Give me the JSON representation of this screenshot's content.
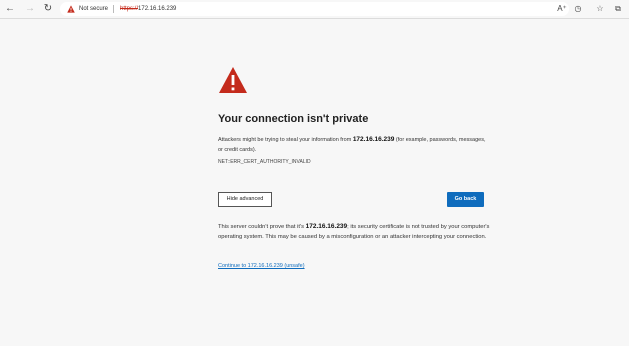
{
  "browser": {
    "security_status": "Not secure",
    "url_scheme": "https://",
    "url_host": "172.16.16.239"
  },
  "page": {
    "heading": "Your connection isn't private",
    "intro_before": "Attackers might be trying to steal your information from ",
    "intro_host": "172.16.16.239",
    "intro_after": " (for example, passwords, messages, or credit cards).",
    "error_code": "NET::ERR_CERT_AUTHORITY_INVALID",
    "hide_advanced_label": "Hide advanced",
    "go_back_label": "Go back",
    "advanced_before": "This server couldn't prove that it's ",
    "advanced_host": "172.16.16.239",
    "advanced_after": "; its security certificate is not trusted by your computer's operating system. This may be caused by a misconfiguration or an attacker intercepting your connection.",
    "proceed_link": "Continue to 172.16.16.239 (unsafe)"
  },
  "colors": {
    "warning_red": "#c42b1c",
    "accent_blue": "#0f6cbd",
    "page_background": "#f7f7f7"
  },
  "icons": {
    "back": "back-arrow-icon",
    "forward": "forward-arrow-icon",
    "refresh": "refresh-icon",
    "warning": "warning-triangle-icon",
    "read_aloud": "read-aloud-icon",
    "tracking": "tracking-prevention-icon",
    "favorites": "favorites-star-icon",
    "collections": "collections-icon"
  }
}
